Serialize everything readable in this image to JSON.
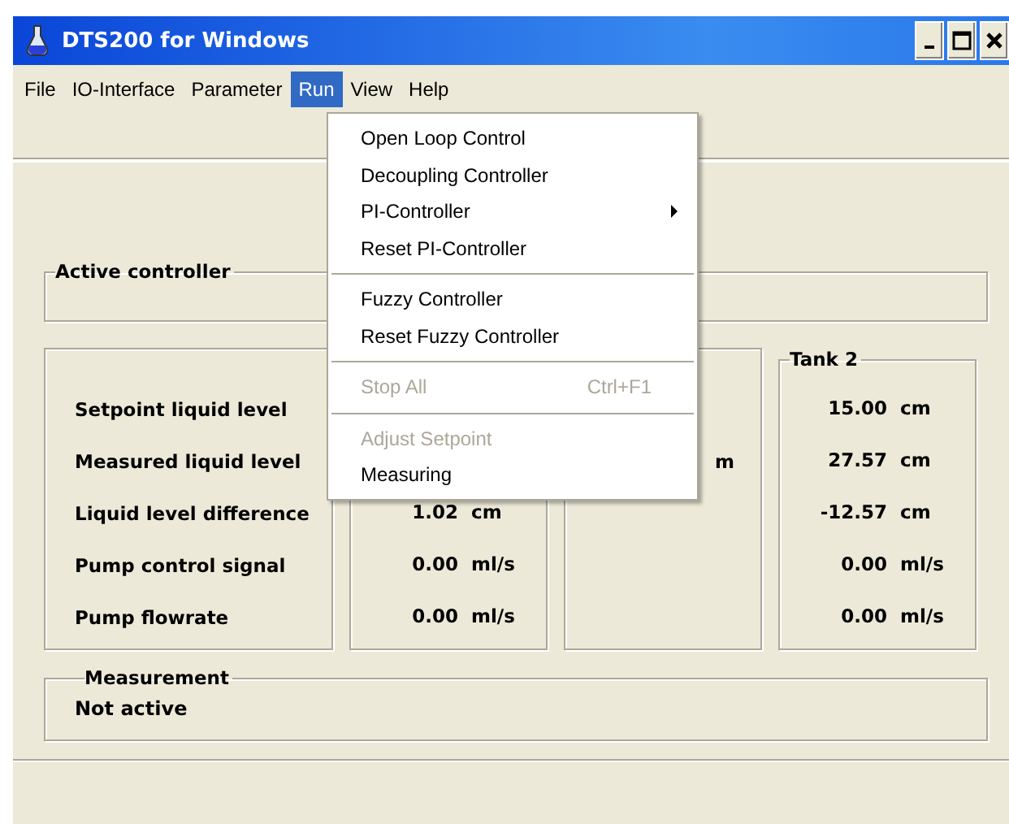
{
  "window": {
    "title": "DTS200 for Windows"
  },
  "menu_bar": [
    {
      "label": "File",
      "selected": false
    },
    {
      "label": "IO-Interface",
      "selected": false
    },
    {
      "label": "Parameter",
      "selected": false
    },
    {
      "label": "Run",
      "selected": true
    },
    {
      "label": "View",
      "selected": false
    },
    {
      "label": "Help",
      "selected": false
    }
  ],
  "run_menu": [
    {
      "kind": "item",
      "label": "Open Loop Control",
      "disabled": false
    },
    {
      "kind": "item",
      "label": "Decoupling Controller",
      "disabled": false
    },
    {
      "kind": "item",
      "label": "PI-Controller",
      "disabled": false,
      "submenu": true
    },
    {
      "kind": "item",
      "label": "Reset PI-Controller",
      "disabled": false
    },
    {
      "kind": "separator"
    },
    {
      "kind": "item",
      "label": "Fuzzy Controller",
      "disabled": false
    },
    {
      "kind": "item",
      "label": "Reset Fuzzy Controller",
      "disabled": false
    },
    {
      "kind": "separator"
    },
    {
      "kind": "item",
      "label": "Stop All",
      "disabled": true,
      "shortcut": "Ctrl+F1"
    },
    {
      "kind": "separator"
    },
    {
      "kind": "item",
      "label": "Adjust Setpoint",
      "disabled": true
    },
    {
      "kind": "item",
      "label": "Measuring",
      "disabled": false
    }
  ],
  "active_controller": {
    "title": "Active controller"
  },
  "quantities": [
    "Setpoint liquid level",
    "Measured liquid level",
    "Liquid level difference",
    "Pump control signal",
    "Pump flowrate"
  ],
  "tank_1": {
    "values": [
      {
        "value": "1.02",
        "unit": "cm"
      },
      {
        "value": "0.00",
        "unit": "ml/s"
      },
      {
        "value": "0.00",
        "unit": "ml/s"
      }
    ]
  },
  "column_3": {
    "text": "m"
  },
  "tank_2": {
    "title": "Tank 2",
    "values": [
      {
        "value": "15.00",
        "unit": "cm"
      },
      {
        "value": "27.57",
        "unit": "cm"
      },
      {
        "value": "-12.57",
        "unit": "cm"
      },
      {
        "value": "0.00",
        "unit": "ml/s"
      },
      {
        "value": "0.00",
        "unit": "ml/s"
      }
    ]
  },
  "measurement": {
    "title": "Measurement",
    "status": "Not active"
  }
}
